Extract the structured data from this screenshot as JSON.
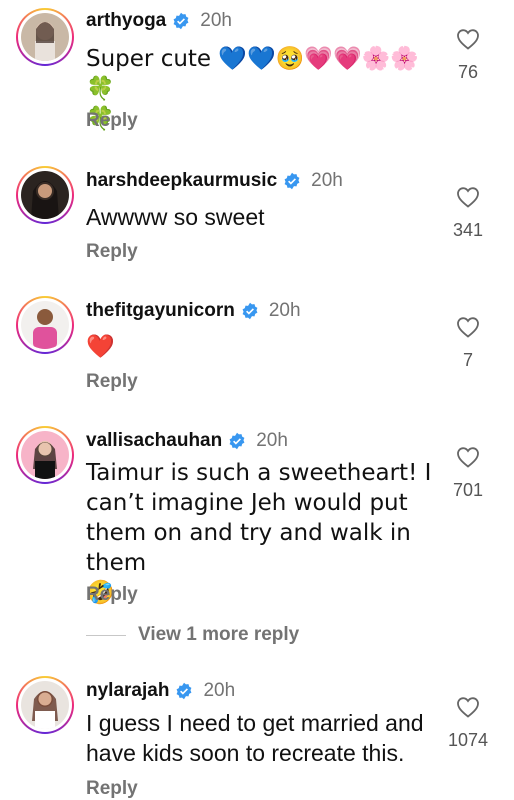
{
  "comments": [
    {
      "username": "arthyoga",
      "time": "20h",
      "text": "Super cute 💙💙🥹💗💗🌸🌸🍀\n🍀",
      "reply": "Reply",
      "likes": "76"
    },
    {
      "username": "harshdeepkaurmusic",
      "time": "20h",
      "text": "Awwww so sweet",
      "reply": "Reply",
      "likes": "341"
    },
    {
      "username": "thefitgayunicorn",
      "time": "20h",
      "text": "❤️",
      "reply": "Reply",
      "likes": "7"
    },
    {
      "username": "vallisachauhan",
      "time": "20h",
      "text": "Taimur is such a sweetheart! I\ncan’t imagine Jeh would put\nthem on and try and walk in them\n🤣",
      "reply": "Reply",
      "likes": "701"
    },
    {
      "username": "nylarajah",
      "time": "20h",
      "text": "I guess I need to get married and\nhave kids soon to recreate this.",
      "reply": "Reply",
      "likes": "1074"
    }
  ],
  "view_more": "View 1 more reply",
  "icons": {
    "like": "heart-outline-icon",
    "verified": "verified-badge-icon"
  },
  "colors": {
    "verified": "#3897f0",
    "secondary_text": "#737373"
  }
}
